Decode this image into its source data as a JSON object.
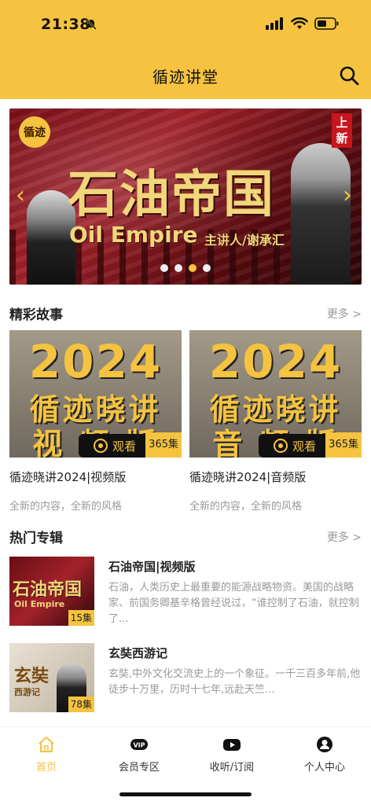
{
  "status": {
    "time": "21:38"
  },
  "header": {
    "title": "循迹讲堂"
  },
  "banner": {
    "logo": "循迹",
    "tag": "上新",
    "title": "石油帝国",
    "subtitle": "Oil Empire",
    "speaker": "主讲人/谢承汇",
    "dots": 4,
    "active_dot": 2
  },
  "stories": {
    "title": "精彩故事",
    "more": "更多 >",
    "items": [
      {
        "cover_year": "2024",
        "cover_line1": "循迹晓讲",
        "cover_line2": "视 频 版",
        "watch": "观看",
        "episodes": "365集",
        "name": "循迹晓讲2024|视频版",
        "desc": "全新的内容，全新的风格"
      },
      {
        "cover_year": "2024",
        "cover_line1": "循迹晓讲",
        "cover_line2": "音 频 版",
        "watch": "观看",
        "episodes": "365集",
        "name": "循迹晓讲2024|音频版",
        "desc": "全新的内容，全新的风格"
      }
    ]
  },
  "albums": {
    "title": "热门专辑",
    "more": "更多 >",
    "items": [
      {
        "cover_title": "石油帝国",
        "cover_sub": "Oil Empire",
        "episodes": "15集",
        "title": "石油帝国|视频版",
        "desc": "石油，人类历史上最重要的能源战略物资。美国的战略家、前国务卿基辛格曾经说过，“谁控制了石油，就控制了..."
      },
      {
        "cover_title": "玄奘",
        "cover_sub": "西游记",
        "episodes": "78集",
        "title": "玄奘西游记",
        "desc": "玄奘,中外文化交流史上的一个象征。一千三百多年前,他徒步十万里，历时十七年,远赴天竺..."
      }
    ]
  },
  "tabbar": {
    "items": [
      {
        "label": "首页",
        "icon": "home-icon",
        "active": true
      },
      {
        "label": "会员专区",
        "icon": "vip-icon",
        "active": false
      },
      {
        "label": "收听/订阅",
        "icon": "play-icon",
        "active": false
      },
      {
        "label": "个人中心",
        "icon": "user-icon",
        "active": false
      }
    ]
  },
  "colors": {
    "accent": "#f5c33f",
    "text": "#222222",
    "muted": "#999999"
  }
}
